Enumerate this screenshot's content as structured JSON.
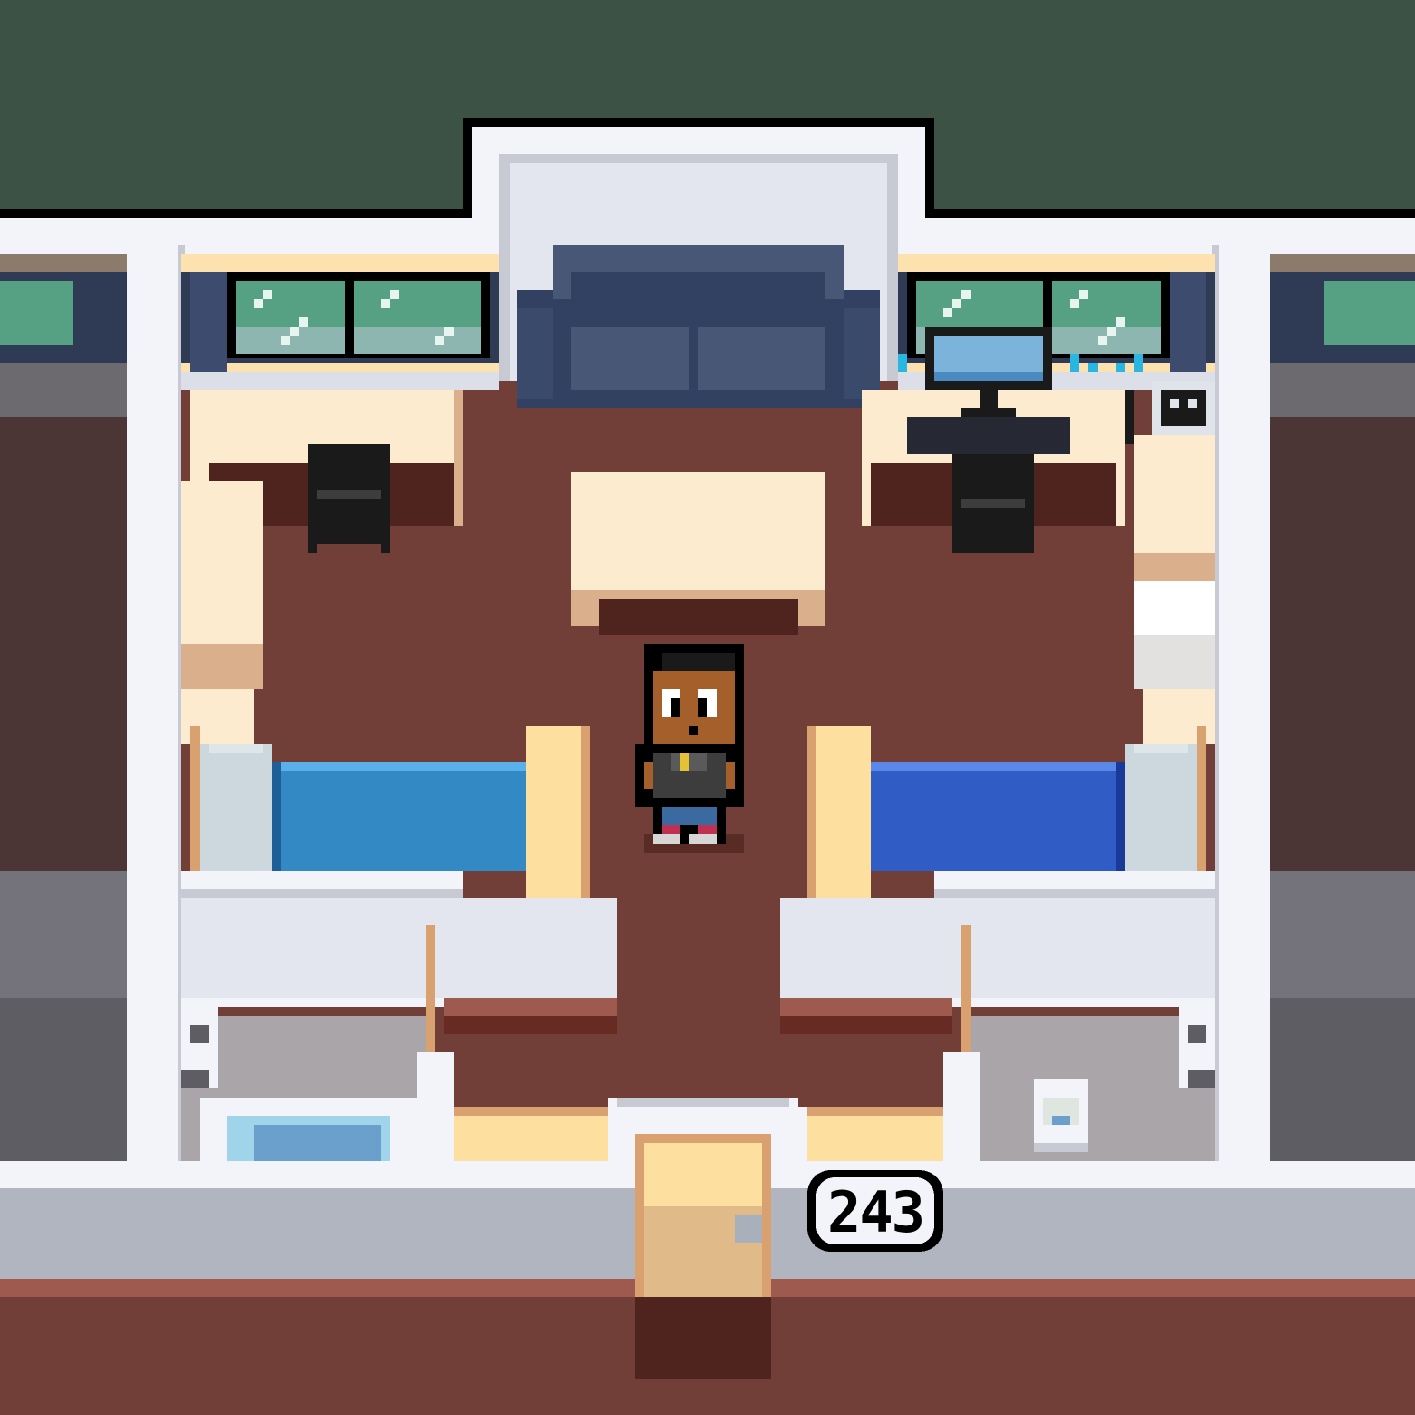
{
  "scene": {
    "type": "top-down pixel-art dormitory room",
    "room_number": "243",
    "palette": {
      "outside": "#3c5245",
      "wall_white": "#f3f4fa",
      "wall_shadow": "#c8cad3",
      "floor": "#713f37",
      "floor_dark": "#50241e",
      "desk_wood": "#fdebd0",
      "bed_left_blanket": "#3289c4",
      "bed_right_blanket": "#2f5cc5",
      "couch": "#475775",
      "window_glass": "#56a083",
      "door": "#e1ba8a"
    }
  },
  "objects": {
    "couch": "couch",
    "window_left": "window",
    "window_right": "window",
    "computer": "computer-monitor",
    "coffee_table": "table",
    "bed_left": "bed",
    "bed_right": "bed",
    "door": "door",
    "sink": "sink",
    "toilet_left": "toilet",
    "toilet_right": "toilet",
    "player": "player-character"
  }
}
